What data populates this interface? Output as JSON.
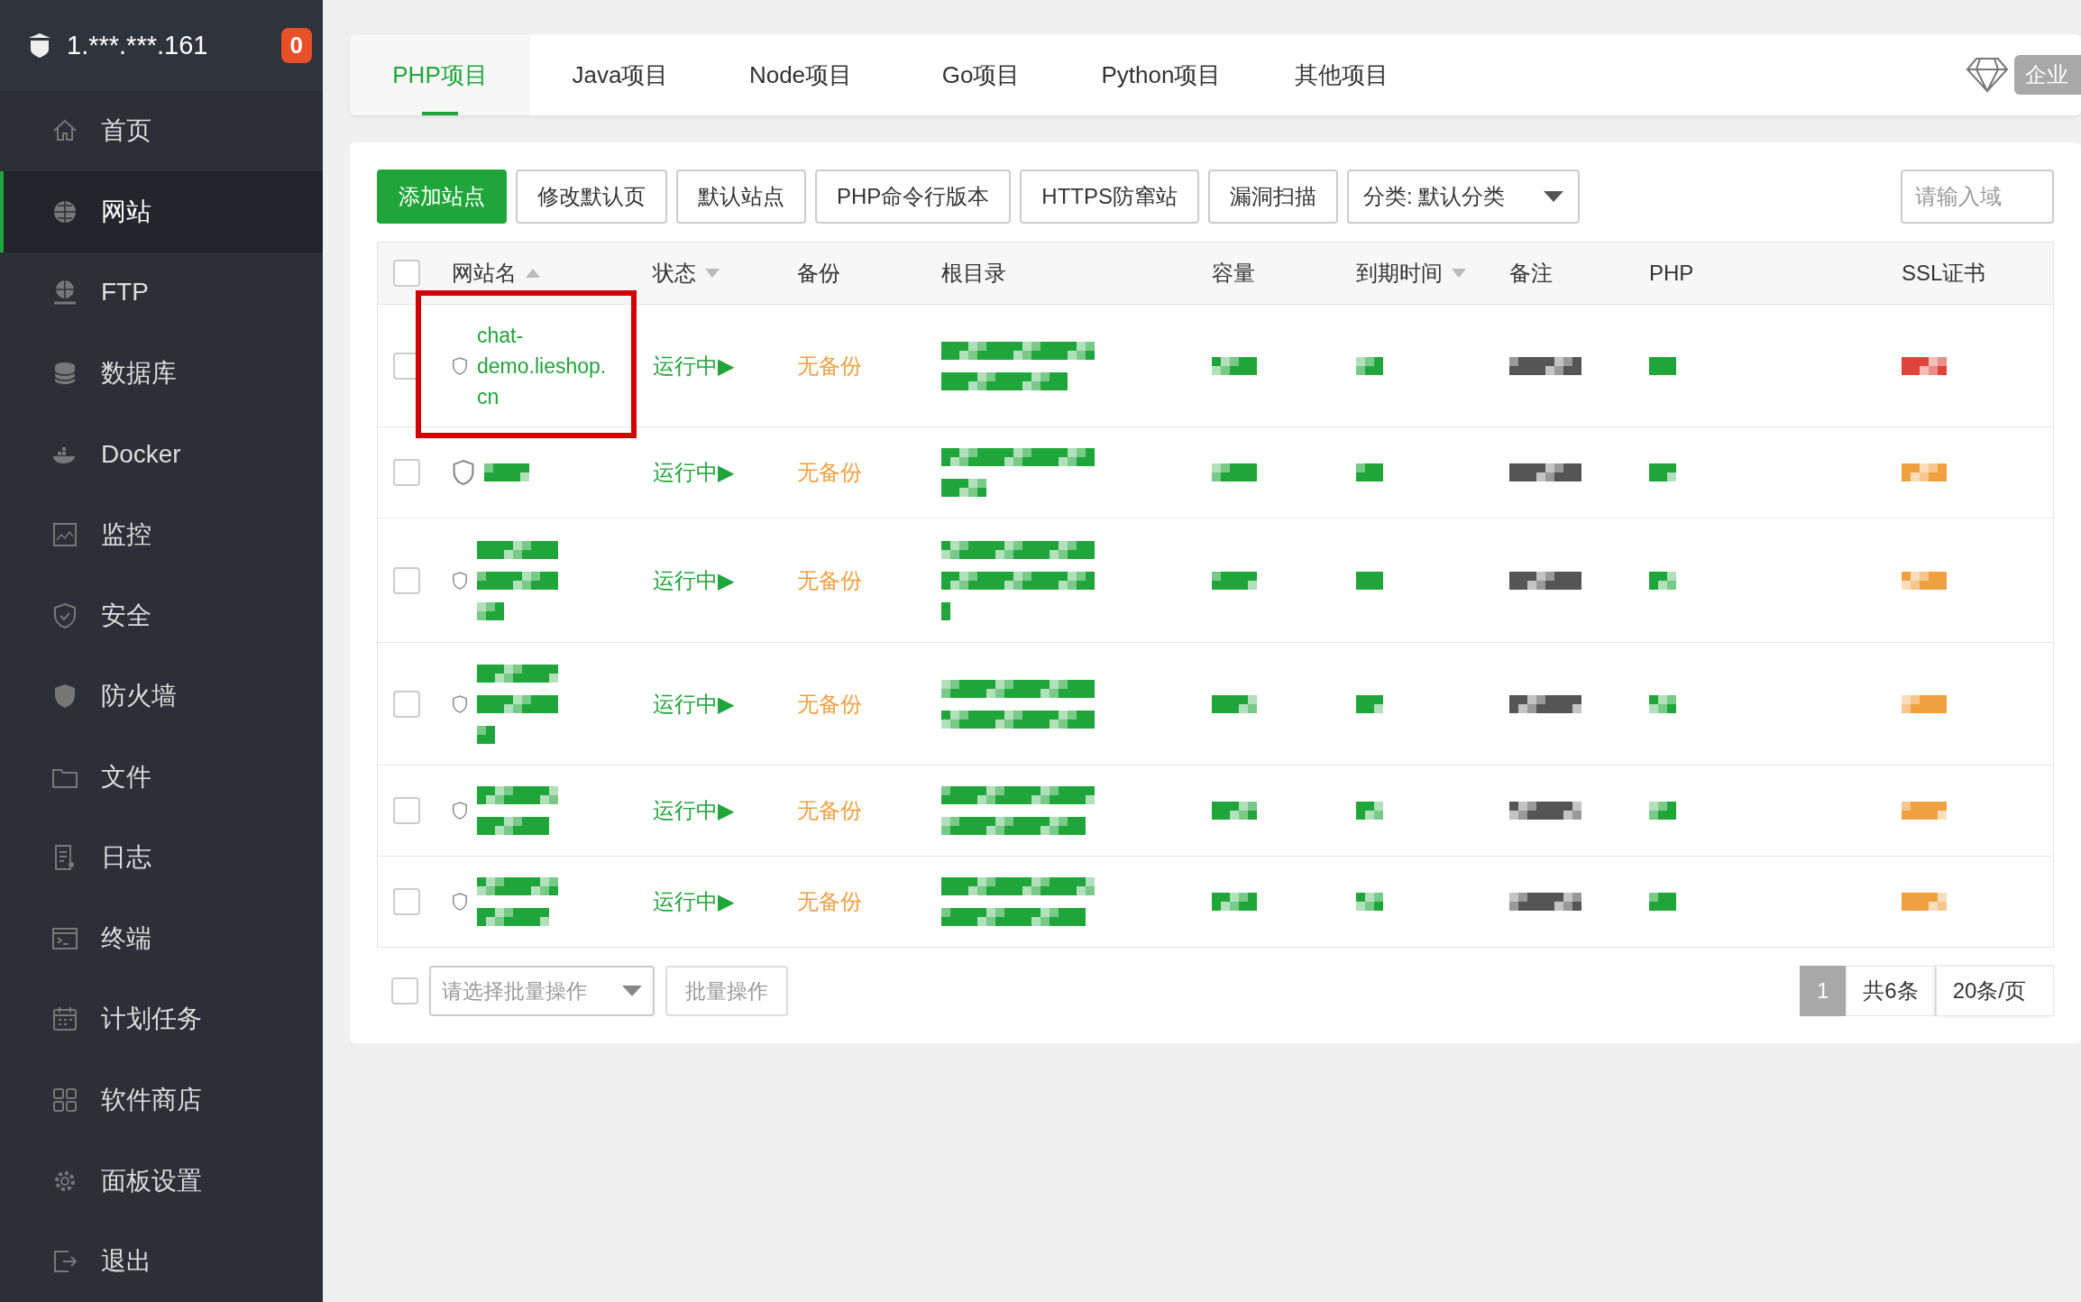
{
  "sidebar": {
    "host": "1.***.***.161",
    "alert_count": "0",
    "items": [
      {
        "label": "首页",
        "selected": false
      },
      {
        "label": "网站",
        "selected": true
      },
      {
        "label": "FTP",
        "selected": false
      },
      {
        "label": "数据库",
        "selected": false
      },
      {
        "label": "Docker",
        "selected": false
      },
      {
        "label": "监控",
        "selected": false
      },
      {
        "label": "安全",
        "selected": false
      },
      {
        "label": "防火墙",
        "selected": false
      },
      {
        "label": "文件",
        "selected": false
      },
      {
        "label": "日志",
        "selected": false
      },
      {
        "label": "终端",
        "selected": false
      },
      {
        "label": "计划任务",
        "selected": false
      },
      {
        "label": "软件商店",
        "selected": false
      },
      {
        "label": "面板设置",
        "selected": false
      },
      {
        "label": "退出",
        "selected": false
      }
    ]
  },
  "tabs": [
    {
      "label": "PHP项目",
      "selected": true
    },
    {
      "label": "Java项目",
      "selected": false
    },
    {
      "label": "Node项目",
      "selected": false
    },
    {
      "label": "Go项目",
      "selected": false
    },
    {
      "label": "Python项目",
      "selected": false
    },
    {
      "label": "其他项目",
      "selected": false
    }
  ],
  "edition_label": "企业",
  "toolbar": [
    {
      "kind": "primary",
      "label": "添加站点"
    },
    {
      "kind": "default",
      "label": "修改默认页"
    },
    {
      "kind": "default",
      "label": "默认站点"
    },
    {
      "kind": "default",
      "label": "PHP命令行版本"
    },
    {
      "kind": "default",
      "label": "HTTPS防窜站"
    },
    {
      "kind": "default",
      "label": "漏洞扫描"
    },
    {
      "kind": "select",
      "label": "分类: 默认分类"
    }
  ],
  "search": {
    "placeholder": "请输入域"
  },
  "table": {
    "all_checked": false,
    "columns": [
      {
        "label": "网站名",
        "kind": "sort_up"
      },
      {
        "label": "状态",
        "kind": "sort_down"
      },
      {
        "label": "备份",
        "kind": "plain"
      },
      {
        "label": "根目录",
        "kind": "plain"
      },
      {
        "label": "容量",
        "kind": "plain"
      },
      {
        "label": "到期时间",
        "kind": "sort_down"
      },
      {
        "label": "备注",
        "kind": "plain"
      },
      {
        "label": "PHP",
        "kind": "plain"
      },
      {
        "label": "SSL证书",
        "kind": "plain"
      }
    ],
    "rows": [
      {
        "name": "chat-demo.lieshop.cn",
        "status": "运行中▶",
        "backup": "无备份",
        "framed": true,
        "checked": false,
        "color": "#e0433a"
      },
      {
        "status": "运行中▶",
        "backup": "无备份",
        "framed": false,
        "checked": false,
        "color": "#f0a040"
      },
      {
        "status": "运行中▶",
        "backup": "无备份",
        "framed": false,
        "checked": false,
        "color": "#f0a040"
      },
      {
        "status": "运行中▶",
        "backup": "无备份",
        "framed": false,
        "checked": false,
        "color": "#f0a040"
      },
      {
        "status": "运行中▶",
        "backup": "无备份",
        "framed": false,
        "checked": false,
        "color": "#f0a040"
      },
      {
        "status": "运行中▶",
        "backup": "无备份",
        "framed": false,
        "checked": false,
        "color": "#f0a040"
      }
    ]
  },
  "footer": {
    "select_all": false,
    "batch_placeholder": "请选择批量操作",
    "batch_button": "批量操作",
    "current_page": "1",
    "total": "共6条",
    "page_size": "20条/页"
  }
}
